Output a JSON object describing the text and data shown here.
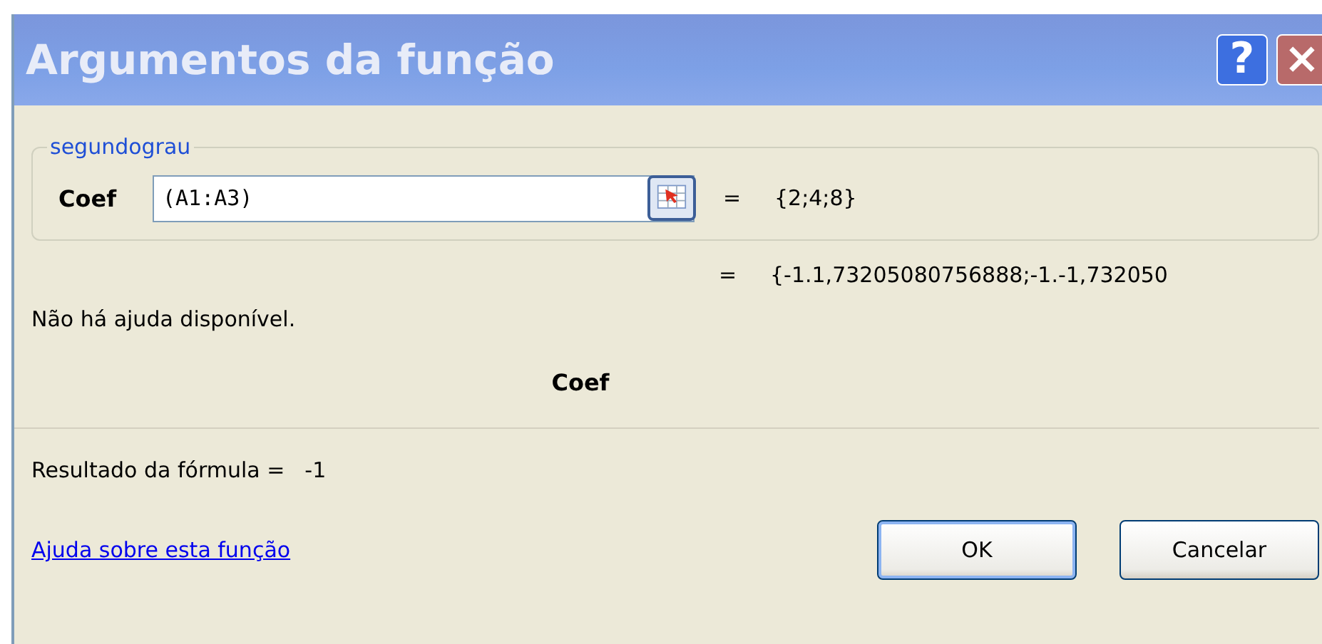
{
  "window": {
    "title": "Argumentos da função",
    "help_button": "?",
    "close_button": "×"
  },
  "group": {
    "legend": "segundograu",
    "arguments": [
      {
        "label": "Coef",
        "value": "(A1:A3)",
        "result": "{2;4;8}"
      }
    ]
  },
  "function_result": "{-1.1,73205080756888;-1.-1,732050",
  "equals": "=",
  "description": "Não há ajuda disponível.",
  "argument_help": "Coef",
  "formula_result": {
    "label": "Resultado da fórmula =",
    "value": "-1"
  },
  "help_link": "Ajuda sobre esta função",
  "buttons": [
    {
      "label": "OK",
      "default": true
    },
    {
      "label": "Cancelar",
      "default": false
    }
  ]
}
